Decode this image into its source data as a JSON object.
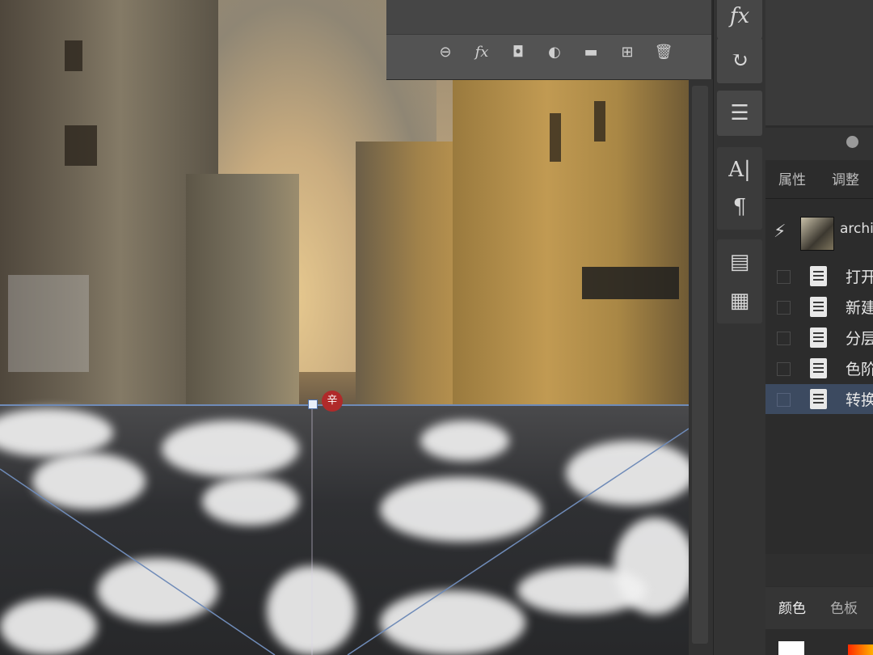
{
  "layers_footer": {
    "icons": [
      "link-icon",
      "fx-icon",
      "mask-icon",
      "adjustment-icon",
      "folder-icon",
      "new-layer-icon",
      "trash-icon"
    ],
    "link_glyph": "⊖",
    "fx_glyph": "fx",
    "mask_glyph": "◘",
    "adjust_glyph": "◐",
    "folder_glyph": "▬",
    "new_glyph": "⊞",
    "trash_glyph": "🗑"
  },
  "dock": {
    "fx_label": "fx",
    "history_glyph": "↻",
    "clone_glyph": "☰",
    "char_label": "A|",
    "para_label": "¶",
    "layout_glyph": "▤",
    "notes_glyph": "▦"
  },
  "panel": {
    "tab_properties": "属性",
    "tab_adjustments": "调整",
    "snapshot_name": "archi",
    "history": [
      {
        "label": "打开"
      },
      {
        "label": "新建"
      },
      {
        "label": "分层"
      },
      {
        "label": "色阶"
      },
      {
        "label": "转换"
      }
    ],
    "tab_color": "颜色",
    "tab_swatches": "色板"
  },
  "canvas": {
    "pivot_glyph": "辛"
  },
  "colors": {
    "selected_row": "#3c4a60",
    "guide": "#6f8bb8",
    "panel_bg": "#2c2c2c"
  }
}
